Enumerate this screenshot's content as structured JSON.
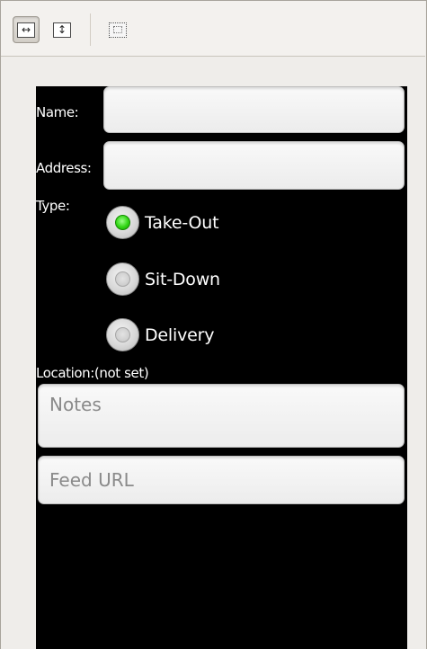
{
  "toolbar": {
    "buttons": [
      {
        "name": "fit-width",
        "glyph": "↔",
        "active": true
      },
      {
        "name": "fit-height",
        "glyph": "↕",
        "active": false
      },
      {
        "name": "zoom-area",
        "glyph": "",
        "active": false
      }
    ]
  },
  "form": {
    "name_label": "Name:",
    "address_label": "Address:",
    "type_label": "Type:",
    "name_value": "",
    "address_value": "",
    "type_options": [
      {
        "label": "Take-Out",
        "checked": true
      },
      {
        "label": "Sit-Down",
        "checked": false
      },
      {
        "label": "Delivery",
        "checked": false
      }
    ],
    "location_label": "Location:",
    "location_value": "(not set)",
    "notes_placeholder": "Notes",
    "feed_url_placeholder": "Feed URL"
  },
  "colors": {
    "screen_background": "#000000",
    "radio_checked": "#31d614",
    "toolbar_background": "#f3f1ee"
  }
}
